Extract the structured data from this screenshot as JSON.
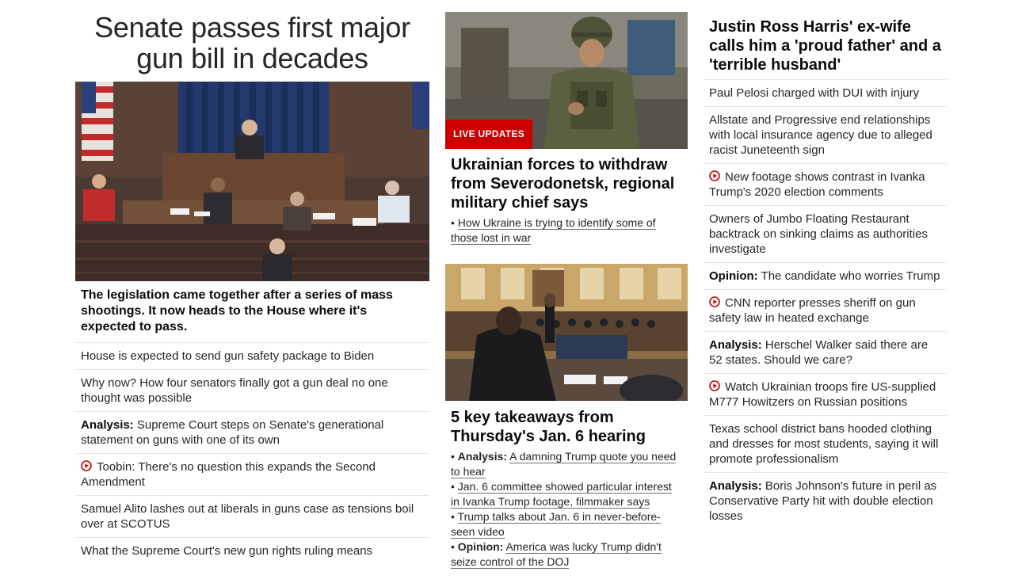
{
  "lead": {
    "headline": "Senate passes first major gun bill in decades",
    "description": "The legislation came together after a series of mass shootings. It now heads to the House where it's expected to pass.",
    "photo_label": "senate-floor-photo",
    "items": [
      {
        "label": "",
        "text": "House is expected to send gun safety package to Biden",
        "video": false
      },
      {
        "label": "",
        "text": "Why now? How four senators finally got a gun deal no one thought was possible",
        "video": false
      },
      {
        "label": "Analysis:",
        "text": " Supreme Court steps on Senate's generational statement on guns with one of its own",
        "video": false
      },
      {
        "label": "",
        "text": "Toobin: There's no question this expands the Second Amendment",
        "video": true
      },
      {
        "label": "",
        "text": "Samuel Alito lashes out at liberals in guns case as tensions boil over at SCOTUS",
        "video": false
      },
      {
        "label": "",
        "text": "What the Supreme Court's new gun rights ruling means",
        "video": false
      }
    ]
  },
  "ukraine": {
    "badge": "LIVE UPDATES",
    "headline": "Ukrainian forces to withdraw from Severodonetsk, regional military chief says",
    "bullets": [
      {
        "label": "",
        "text": "How Ukraine is trying to identify some of those lost in war"
      }
    ]
  },
  "jan6": {
    "headline": "5 key takeaways from Thursday's Jan. 6 hearing",
    "bullets": [
      {
        "label": "Analysis:",
        "text": "A damning Trump quote you need to hear"
      },
      {
        "label": "",
        "text": "Jan. 6 committee showed particular interest in Ivanka Trump footage, filmmaker says"
      },
      {
        "label": "",
        "text": "Trump talks about Jan. 6 in never-before-seen video"
      },
      {
        "label": "Opinion:",
        "text": "America was lucky Trump didn't seize control of the DOJ"
      }
    ]
  },
  "right": {
    "headline": "Justin Ross Harris' ex-wife calls him a 'proud father' and a 'terrible husband'",
    "items": [
      {
        "label": "",
        "text": "Paul Pelosi charged with DUI with injury",
        "video": false
      },
      {
        "label": "",
        "text": "Allstate and Progressive end relationships with local insurance agency due to alleged racist Juneteenth sign",
        "video": false
      },
      {
        "label": "",
        "text": "New footage shows contrast in Ivanka Trump's 2020 election comments",
        "video": true
      },
      {
        "label": "",
        "text": "Owners of Jumbo Floating Restaurant backtrack on sinking claims as authorities investigate",
        "video": false
      },
      {
        "label": "Opinion:",
        "text": " The candidate who worries Trump",
        "video": false
      },
      {
        "label": "",
        "text": "CNN reporter presses sheriff on gun safety law in heated exchange",
        "video": true
      },
      {
        "label": "Analysis:",
        "text": " Herschel Walker said there are 52 states. Should we care?",
        "video": false
      },
      {
        "label": "",
        "text": "Watch Ukrainian troops fire US-supplied M777 Howitzers on Russian positions",
        "video": true
      },
      {
        "label": "",
        "text": "Texas school district bans hooded clothing and dresses for most students, saying it will promote professionalism",
        "video": false
      },
      {
        "label": "Analysis:",
        "text": " Boris Johnson's future in peril as Conservative Party hit with double election losses",
        "video": false
      }
    ]
  },
  "colors": {
    "accent": "#cc0000",
    "divider": "#e6e6e6",
    "text": "#0c0c0c"
  },
  "icons": {
    "video": "play-circle-icon"
  }
}
